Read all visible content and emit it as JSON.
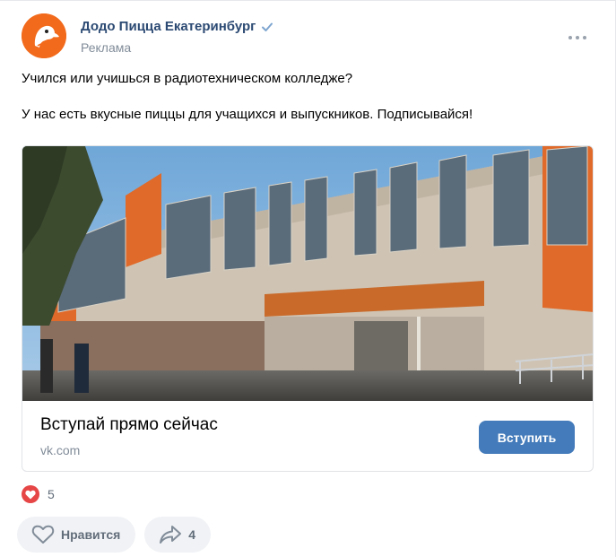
{
  "post": {
    "author": "Додо Пицца Екатеринбург",
    "subtitle": "Реклама",
    "text_lines": [
      "Учился или учишься в радиотехническом колледже?",
      "У нас есть вкусные пиццы для учащихся и выпускников. Подписывайся!"
    ]
  },
  "card": {
    "title": "Вступай прямо сейчас",
    "domain": "vk.com",
    "button_label": "Вступить"
  },
  "reactions": {
    "likes_count": "5"
  },
  "actions": {
    "like_label": "Нравится",
    "share_count": "4"
  },
  "colors": {
    "brand": "#f26a1b",
    "link": "#2c4a73",
    "button": "#447bba",
    "heart": "#e64646"
  }
}
